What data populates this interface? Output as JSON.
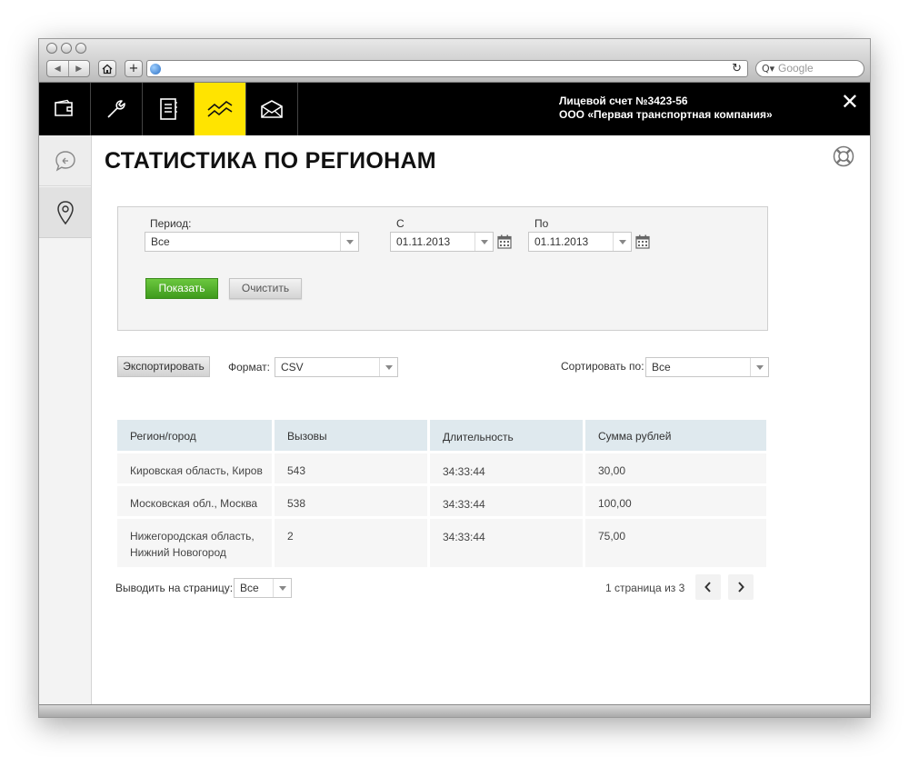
{
  "browser": {
    "nav_back": "◀",
    "nav_forward": "▶",
    "home_icon": "home-icon",
    "new_tab": "+",
    "reload": "↻",
    "search_icon": "Q▾",
    "search_placeholder": "Google"
  },
  "topbar": {
    "tools": [
      {
        "icon": "wallet-icon"
      },
      {
        "icon": "wrench-icon"
      },
      {
        "icon": "notebook-icon"
      },
      {
        "icon": "chart-line-icon",
        "active": true
      },
      {
        "icon": "envelope-icon"
      }
    ],
    "account_line1": "Лицевой счет №3423-56",
    "account_line2": "ООО «Первая транспортная компания»",
    "close": "✕",
    "accent": "#ffe400"
  },
  "sidebar": {
    "items": [
      {
        "icon": "chat-bubble-icon"
      },
      {
        "icon": "map-pin-icon"
      }
    ]
  },
  "page": {
    "title": "СТАТИСТИКА ПО РЕГИОНАМ",
    "help_icon": "lifebuoy-icon"
  },
  "filter": {
    "period_label": "Период:",
    "period_value": "Все",
    "from_label": "С",
    "from_value": "01.11.2013",
    "to_label": "По",
    "to_value": "01.11.2013",
    "show_button": "Показать",
    "clear_button": "Очистить",
    "show_button_color": "#4caf2a"
  },
  "toolbar": {
    "export_button": "Экспортировать",
    "format_label": "Формат:",
    "format_value": "CSV",
    "sort_label": "Сортировать по:",
    "sort_value": "Все"
  },
  "table": {
    "headers": [
      "Регион/город",
      "Вызовы",
      "Длительность",
      "Сумма рублей"
    ],
    "rows": [
      {
        "region": "Кировская область, Киров",
        "calls": "543",
        "duration": "34:33:44",
        "sum": "30,00"
      },
      {
        "region": "Московская обл., Москва",
        "calls": "538",
        "duration": "34:33:44",
        "sum": "100,00"
      },
      {
        "region": "Нижегородская область,",
        "region2": "Нижний Новогород",
        "calls": "2",
        "duration": "34:33:44",
        "sum": "75,00"
      }
    ]
  },
  "pagination": {
    "per_page_label": "Выводить на страницу:",
    "per_page_value": "Все",
    "page_info": "1 страница из 3",
    "prev": "‹",
    "next": "›"
  }
}
